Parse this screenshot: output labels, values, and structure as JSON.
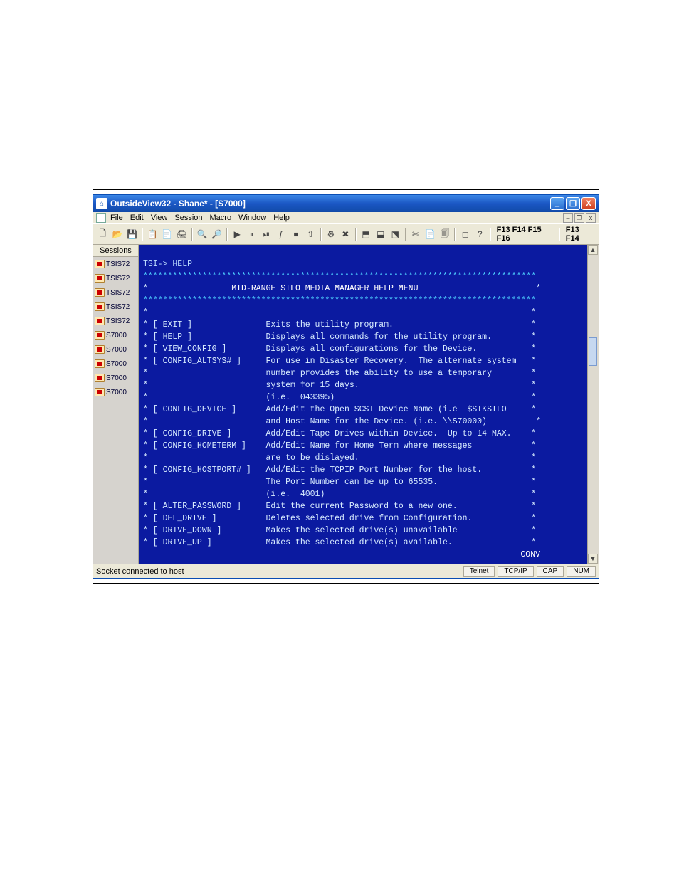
{
  "window": {
    "title": "OutsideView32 - Shane* - [S7000]",
    "min_glyph": "_",
    "max_glyph": "❐",
    "close_glyph": "X"
  },
  "mdi": {
    "restore_glyph": "–",
    "max_glyph": "❐",
    "close_glyph": "x"
  },
  "menubar": [
    "File",
    "Edit",
    "View",
    "Session",
    "Macro",
    "Window",
    "Help"
  ],
  "toolbar": {
    "group1": [
      "🗋",
      "📂",
      "💾"
    ],
    "group2": [
      "📋",
      "📄",
      "🖨"
    ],
    "group3": [
      "🔍",
      "🔎"
    ],
    "group4": [
      "▶",
      "⏸",
      "⏯",
      "ƒ",
      "⏹",
      "⇧"
    ],
    "group5": [
      "⚙",
      "✖"
    ],
    "group6": [
      "⬒",
      "⬓",
      "⬔"
    ],
    "group7": [
      "✄",
      "📄",
      "🗐"
    ],
    "group8": [
      "◻",
      "?"
    ],
    "fkeys1": "F13 F14 F15 F16",
    "fkeys2": "F13 F14"
  },
  "sessions": {
    "header": "Sessions",
    "items": [
      "TSIS72",
      "TSIS72",
      "TSIS72",
      "TSIS72",
      "TSIS72",
      "S7000",
      "S7000",
      "S7000",
      "S7000",
      "S7000"
    ]
  },
  "terminal": {
    "prompt": "TSI-> HELP",
    "star_row": "********************************************************************************",
    "heading": "                 MID-RANGE SILO MEDIA MANAGER HELP MENU",
    "body_lines": [
      "*                                                                              *",
      "* [ EXIT ]               Exits the utility program.                            *",
      "* [ HELP ]               Displays all commands for the utility program.        *",
      "* [ VIEW_CONFIG ]        Displays all configurations for the Device.           *",
      "* [ CONFIG_ALTSYS# ]     For use in Disaster Recovery.  The alternate system   *",
      "*                        number provides the ability to use a temporary        *",
      "*                        system for 15 days.                                   *",
      "*                        (i.e.  043395)                                        *",
      "* [ CONFIG_DEVICE ]      Add/Edit the Open SCSI Device Name (i.e  $STKSILO     *",
      "*                        and Host Name for the Device. (i.e. \\\\S70000)          *",
      "* [ CONFIG_DRIVE ]       Add/Edit Tape Drives within Device.  Up to 14 MAX.    *",
      "* [ CONFIG_HOMETERM ]    Add/Edit Name for Home Term where messages            *",
      "*                        are to be dislayed.                                   *",
      "* [ CONFIG_HOSTPORT# ]   Add/Edit the TCPIP Port Number for the host.          *",
      "*                        The Port Number can be up to 65535.                   *",
      "*                        (i.e.  4001)                                          *",
      "* [ ALTER_PASSWORD ]     Edit the current Password to a new one.               *",
      "* [ DEL_DRIVE ]          Deletes selected drive from Configuration.            *",
      "* [ DRIVE_DOWN ]         Makes the selected drive(s) unavailable               *",
      "* [ DRIVE_UP ]           Makes the selected drive(s) available.                *"
    ],
    "conv": "CONV"
  },
  "statusbar": {
    "message": "Socket connected to host",
    "cells": [
      "Telnet",
      "TCP/IP",
      "CAP",
      "NUM"
    ]
  }
}
